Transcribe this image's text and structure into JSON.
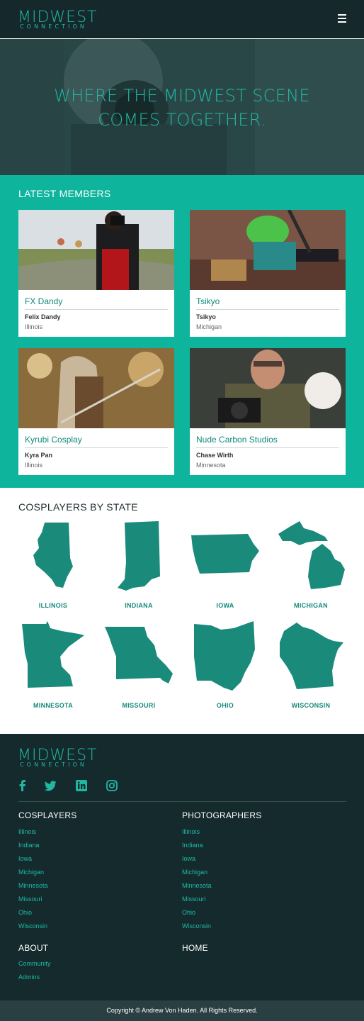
{
  "brand": {
    "name": "MIDWEST",
    "tagline": "CONNECTION"
  },
  "hero": {
    "title": "WHERE THE MIDWEST SCENE COMES TOGETHER."
  },
  "latest": {
    "title": "LATEST MEMBERS",
    "members": [
      {
        "name": "FX Dandy",
        "real_name": "Felix Dandy",
        "state": "Illinois"
      },
      {
        "name": "Tsikyo",
        "real_name": "Tsikyo",
        "state": "Michigan"
      },
      {
        "name": "Kyrubi Cosplay",
        "real_name": "Kyra Pan",
        "state": "Illinois"
      },
      {
        "name": "Nude Carbon Studios",
        "real_name": "Chase Wirth",
        "state": "Minnesota"
      }
    ]
  },
  "states": {
    "title": "COSPLAYERS BY STATE",
    "items": [
      "ILLINOIS",
      "INDIANA",
      "IOWA",
      "MICHIGAN",
      "MINNESOTA",
      "MISSOURI",
      "OHIO",
      "WISCONSIN"
    ]
  },
  "footer": {
    "social_icons": [
      "facebook-icon",
      "twitter-icon",
      "linkedin-icon",
      "instagram-icon"
    ],
    "cosplayers": {
      "title": "COSPLAYERS",
      "links": [
        "Illinois",
        "Indiana",
        "Iowa",
        "Michigan",
        "Minnesota",
        "Missouri",
        "Ohio",
        "Wisconsin"
      ]
    },
    "photographers": {
      "title": "PHOTOGRAPHERS",
      "links": [
        "Illinois",
        "Indiana",
        "Iowa",
        "Michigan",
        "Minnesota",
        "Missouri",
        "Ohio",
        "Wisconsin"
      ]
    },
    "about": {
      "title": "ABOUT",
      "links": [
        "Community",
        "Admins"
      ]
    },
    "home": {
      "title": "HOME"
    },
    "copyright": "Copyright © Andrew Von Haden. All Rights Reserved."
  },
  "colors": {
    "teal": "#0fb49c",
    "dark": "#142a2d",
    "map": "#1a8a7b",
    "accent": "#21b8a2"
  }
}
